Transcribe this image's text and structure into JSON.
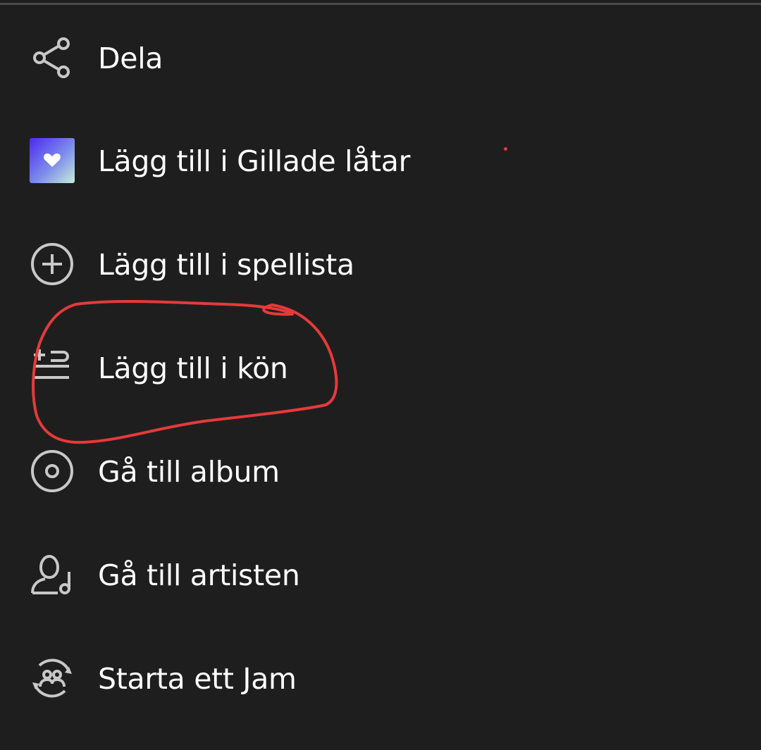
{
  "menu": {
    "items": [
      {
        "id": "share",
        "label": "Dela",
        "icon": "share-icon"
      },
      {
        "id": "liked",
        "label": "Lägg till i Gillade låtar",
        "icon": "liked-songs-icon"
      },
      {
        "id": "playlist",
        "label": "Lägg till i spellista",
        "icon": "add-circle-icon"
      },
      {
        "id": "queue",
        "label": "Lägg till i kön",
        "icon": "add-to-queue-icon"
      },
      {
        "id": "album",
        "label": "Gå till album",
        "icon": "album-icon"
      },
      {
        "id": "artist",
        "label": "Gå till artisten",
        "icon": "artist-icon"
      },
      {
        "id": "jam",
        "label": "Starta ett Jam",
        "icon": "jam-icon"
      }
    ]
  },
  "colors": {
    "background": "#1f1e1f",
    "text": "#ffffff",
    "icon": "#c8c8c8",
    "annotation": "#e53a3a",
    "liked_gradient_start": "#4b2bf0",
    "liked_gradient_end": "#c4efd9"
  }
}
